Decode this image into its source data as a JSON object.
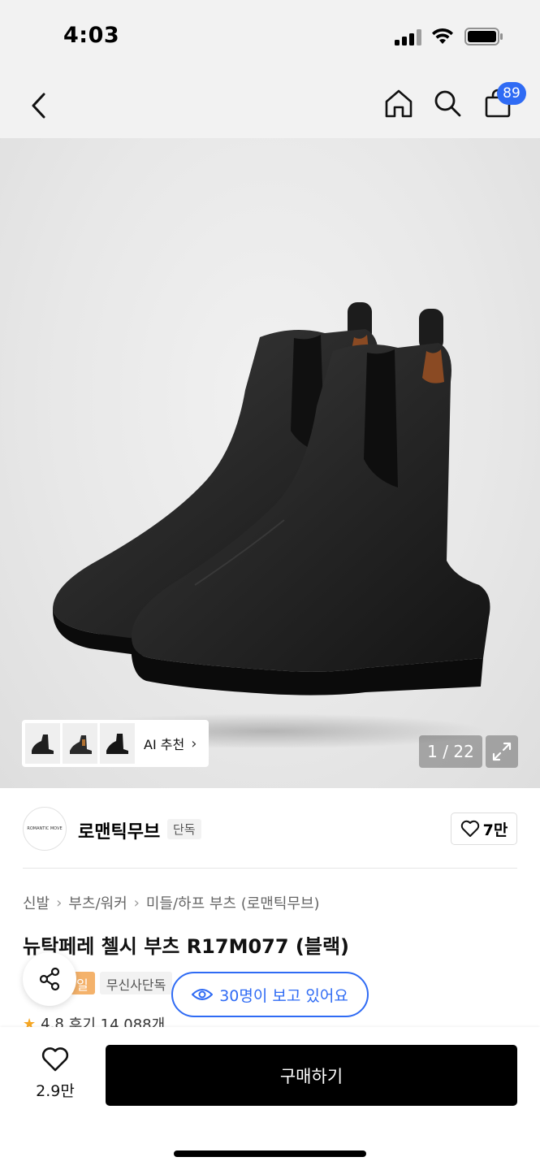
{
  "status_bar": {
    "time": "4:03",
    "icons": [
      "signal-icon",
      "wifi-icon",
      "battery-icon"
    ]
  },
  "nav": {
    "back_icon": "chevron-left-icon",
    "home_icon": "home-icon",
    "search_icon": "search-icon",
    "cart_icon": "shopping-bag-icon",
    "cart_count": "89"
  },
  "gallery": {
    "ai_label": "AI 추천",
    "page_indicator": "1 / 22",
    "expand_icon": "expand-icon"
  },
  "brand": {
    "logo_text": "ROMANTIC MOVE",
    "name": "로맨틱무브",
    "tag": "단독",
    "like_count": "7만"
  },
  "breadcrumb": [
    "신발",
    "부츠/워커",
    "미들/하프 부츠 (로맨틱무브)"
  ],
  "product": {
    "title": "뉴탁페레 첼시 부츠 R17M077 (블랙)",
    "badges": [
      "일",
      "무신사단독"
    ],
    "viewers": "30명이 보고 있어요",
    "rating": "4.8",
    "reviews": "후기 14,088개"
  },
  "bottom_bar": {
    "like_count": "2.9만",
    "buy_label": "구매하기"
  },
  "colors": {
    "accent_blue": "#2f6bf4",
    "buy_button": "#000000",
    "badge_orange": "#f4b26b"
  }
}
